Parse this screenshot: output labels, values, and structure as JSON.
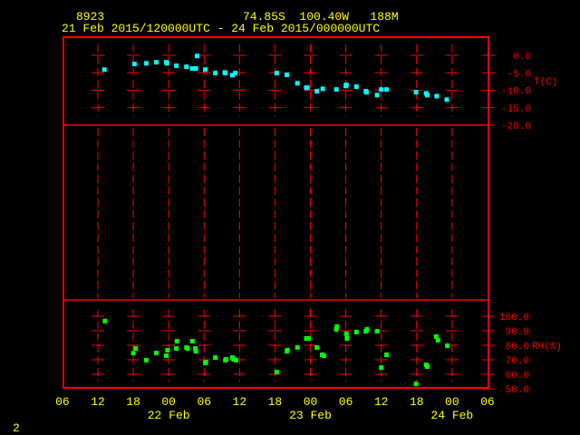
{
  "header": {
    "station_id": "8923",
    "location": "74.85S  100.40W   188M",
    "period": "21 Feb 2015/120000UTC - 24 Feb 2015/000000UTC"
  },
  "page_number": "2",
  "colors": {
    "frame": "#ff0000",
    "text": "#ffff00",
    "temperature": "#00ffff",
    "humidity": "#00ff00"
  },
  "chart_data": [
    {
      "type": "scatter",
      "title": "Temperature",
      "ylabel": "T(C)",
      "x_unit": "hours since 21 Feb 2015 12 UTC",
      "xlim": [
        -6,
        66
      ],
      "ylim": [
        -20,
        5
      ],
      "yticks": [
        0,
        -5,
        -10,
        -15,
        -20
      ],
      "ytick_labels": [
        "0.0",
        "-5.0",
        "-10.0",
        "-15.0",
        "-20.0"
      ],
      "x": [
        1.1,
        6.2,
        8.2,
        9.9,
        11.6,
        11.7,
        13.3,
        15.0,
        16.0,
        16.6,
        16.8,
        18.2,
        19.9,
        21.5,
        21.6,
        22.8,
        23.3,
        30.3,
        32.0,
        33.8,
        35.3,
        35.5,
        37.1,
        38.1,
        40.4,
        42.0,
        42.1,
        43.8,
        45.4,
        45.5,
        47.3,
        48.0,
        48.9,
        53.9,
        55.6,
        55.8,
        57.4,
        59.1
      ],
      "y": [
        -4.1,
        -2.5,
        -2.3,
        -2.0,
        -2.0,
        -2.3,
        -3.0,
        -3.3,
        -3.8,
        -3.8,
        -0.2,
        -4.1,
        -5.1,
        -4.9,
        -5.1,
        -5.7,
        -5.1,
        -5.1,
        -5.6,
        -8.0,
        -9.3,
        -9.3,
        -10.3,
        -9.6,
        -9.8,
        -8.8,
        -8.5,
        -9.0,
        -10.3,
        -10.6,
        -11.4,
        -9.8,
        -9.8,
        -10.6,
        -10.9,
        -11.4,
        -11.7,
        -12.7
      ]
    },
    {
      "type": "scatter",
      "title": "Relative Humidity",
      "ylabel": "RH(%)",
      "x_unit": "hours since 21 Feb 2015 12 UTC",
      "xlim": [
        -6,
        66
      ],
      "ylim": [
        50,
        105
      ],
      "yticks": [
        100,
        90,
        80,
        70,
        60,
        50
      ],
      "ytick_labels": [
        "100.0",
        "90.0",
        "80.0",
        "70.0",
        "60.0",
        "50.0"
      ],
      "x": [
        1.2,
        6.0,
        6.4,
        8.2,
        9.9,
        11.6,
        11.8,
        13.3,
        13.4,
        15.0,
        15.2,
        16.0,
        16.5,
        16.6,
        18.2,
        18.3,
        19.9,
        21.6,
        21.7,
        22.8,
        23.0,
        23.4,
        30.3,
        32.0,
        32.1,
        33.8,
        35.3,
        35.7,
        37.1,
        38.0,
        38.3,
        40.4,
        40.5,
        42.1,
        42.2,
        43.8,
        45.4,
        45.6,
        47.3,
        48.0,
        48.9,
        53.9,
        55.6,
        55.8,
        57.3,
        57.6,
        59.2
      ],
      "y": [
        96.7,
        74.5,
        77.8,
        69.7,
        74.7,
        72.8,
        76.6,
        77.8,
        82.8,
        78.5,
        77.8,
        82.8,
        77.8,
        75.9,
        67.8,
        68.4,
        71.5,
        69.7,
        70.3,
        71.5,
        70.3,
        69.7,
        61.5,
        75.9,
        76.6,
        78.5,
        84.7,
        84.7,
        78.5,
        73.4,
        72.8,
        91.0,
        92.9,
        87.9,
        84.7,
        89.1,
        89.7,
        91.0,
        89.7,
        64.6,
        73.4,
        53.3,
        66.5,
        65.3,
        86.0,
        83.5,
        79.7
      ]
    }
  ],
  "x_axis": {
    "tick_hours": [
      -6,
      0,
      6,
      12,
      18,
      24,
      30,
      36,
      42,
      48,
      54,
      60,
      66
    ],
    "tick_labels": [
      "06",
      "12",
      "18",
      "00",
      "06",
      "12",
      "18",
      "00",
      "06",
      "12",
      "18",
      "00",
      "06"
    ],
    "date_labels": [
      {
        "hour": 12,
        "label": "22 Feb"
      },
      {
        "hour": 36,
        "label": "23 Feb"
      },
      {
        "hour": 60,
        "label": "24 Feb"
      }
    ]
  }
}
